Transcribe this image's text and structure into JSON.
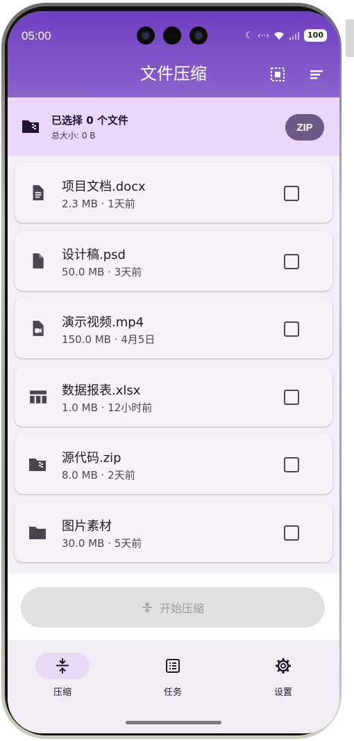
{
  "status_bar": {
    "time": "05:00",
    "battery": "100"
  },
  "header": {
    "title": "文件压缩"
  },
  "selection": {
    "title": "已选择 0 个文件",
    "total_size": "总大小: 0 B",
    "zip_label": "ZIP"
  },
  "files": [
    {
      "name": "项目文档.docx",
      "meta": "2.3 MB · 1天前",
      "icon": "document-icon"
    },
    {
      "name": "设计稿.psd",
      "meta": "50.0 MB · 3天前",
      "icon": "file-icon"
    },
    {
      "name": "演示视频.mp4",
      "meta": "150.0 MB · 4月5日",
      "icon": "video-file-icon"
    },
    {
      "name": "数据报表.xlsx",
      "meta": "1.0 MB · 12小时前",
      "icon": "table-icon"
    },
    {
      "name": "源代码.zip",
      "meta": "8.0 MB · 2天前",
      "icon": "zip-folder-icon"
    },
    {
      "name": "图片素材",
      "meta": "30.0 MB · 5天前",
      "icon": "folder-icon"
    }
  ],
  "action": {
    "start_label": "开始压缩"
  },
  "nav": [
    {
      "label": "压缩",
      "icon": "compress-icon",
      "active": true
    },
    {
      "label": "任务",
      "icon": "task-list-icon",
      "active": false
    },
    {
      "label": "设置",
      "icon": "gear-icon",
      "active": false
    }
  ],
  "colors": {
    "header": "#7a4fc6",
    "selection_bar": "#ead7fb",
    "zip_button": "#6c5a86",
    "card": "#f7f1f8"
  }
}
